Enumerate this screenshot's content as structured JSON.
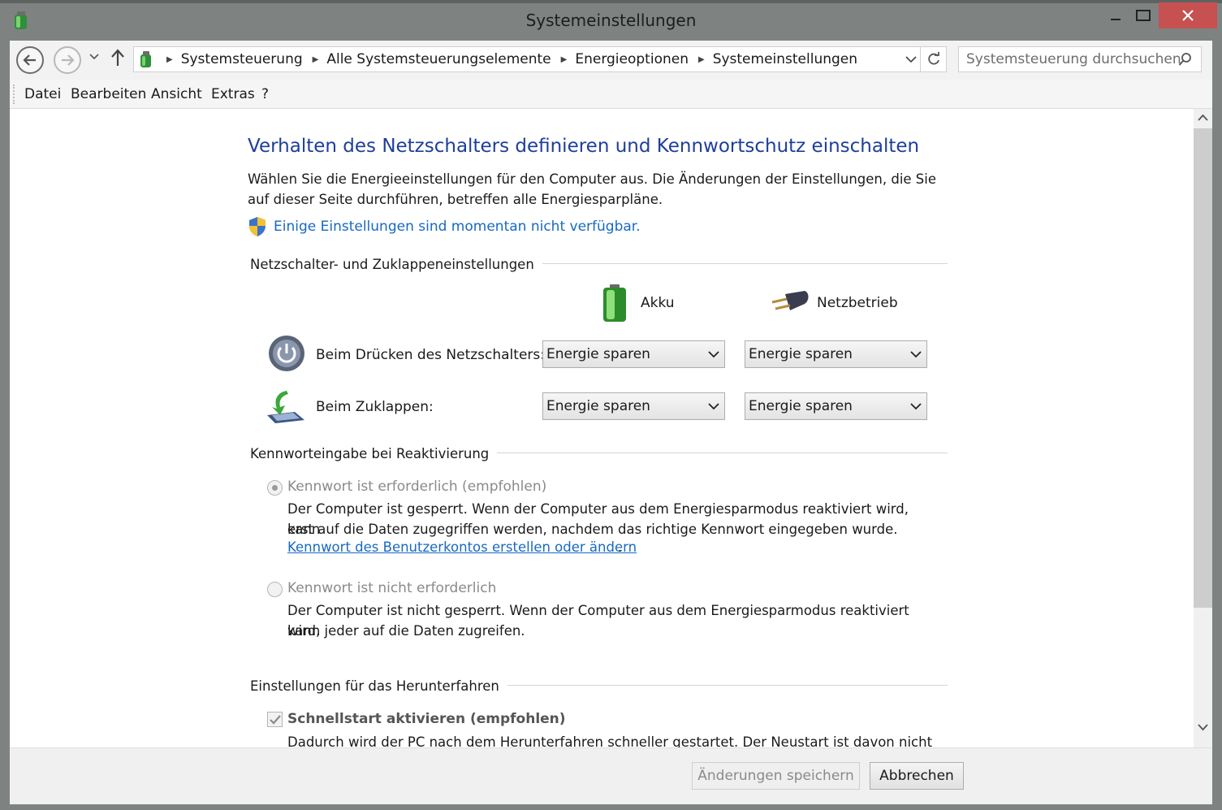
{
  "window": {
    "title": "Systemeinstellungen"
  },
  "address": {
    "breadcrumbs": [
      "Systemsteuerung",
      "Alle Systemsteuerungselemente",
      "Energieoptionen",
      "Systemeinstellungen"
    ],
    "search_placeholder": "Systemsteuerung durchsuchen"
  },
  "menu": [
    "Datei",
    "Bearbeiten",
    "Ansicht",
    "Extras",
    "?"
  ],
  "page": {
    "heading": "Verhalten des Netzschalters definieren und Kennwortschutz einschalten",
    "intro": "Wählen Sie die Energieeinstellungen für den Computer aus. Die Änderungen der Einstellungen, die Sie auf dieser Seite durchführen, betreffen alle Energiesparpläne.",
    "unavailable_link": "Einige Einstellungen sind momentan nicht verfügbar."
  },
  "power_section": {
    "title": "Netzschalter- und Zuklappeneinstellungen",
    "col_battery": "Akku",
    "col_plugged": "Netzbetrieb",
    "rows": [
      {
        "label": "Beim Drücken des Netzschalters:",
        "battery": "Energie sparen",
        "plugged": "Energie sparen"
      },
      {
        "label": "Beim Zuklappen:",
        "battery": "Energie sparen",
        "plugged": "Energie sparen"
      }
    ]
  },
  "password_section": {
    "title": "Kennworteingabe bei Reaktivierung",
    "opt_required": {
      "label": "Kennwort ist erforderlich (empfohlen)",
      "selected": true,
      "desc_line1": "Der Computer ist gesperrt. Wenn der Computer aus dem Energiesparmodus reaktiviert wird, kann",
      "desc_line2": "erst auf die Daten zugegriffen werden, nachdem das richtige Kennwort eingegeben wurde.",
      "link": "Kennwort des Benutzerkontos erstellen oder ändern",
      "link_suffix": "."
    },
    "opt_not_required": {
      "label": "Kennwort ist nicht erforderlich",
      "selected": false,
      "desc_line1": "Der Computer ist nicht gesperrt. Wenn der Computer aus dem Energiesparmodus reaktiviert wird,",
      "desc_line2": "kann jeder auf die Daten zugreifen."
    }
  },
  "shutdown_section": {
    "title": "Einstellungen für das Herunterfahren",
    "fast_start_label": "Schnellstart aktivieren (empfohlen)",
    "fast_start_checked": true,
    "fast_start_desc_cut": "Dadurch wird der PC nach dem Herunterfahren schneller gestartet. Der Neustart ist davon nicht"
  },
  "footer": {
    "save_label": "Änderungen speichern",
    "cancel_label": "Abbrechen"
  },
  "colors": {
    "heading": "#1e3e9a",
    "link": "#1769c4",
    "close": "#c75050"
  }
}
